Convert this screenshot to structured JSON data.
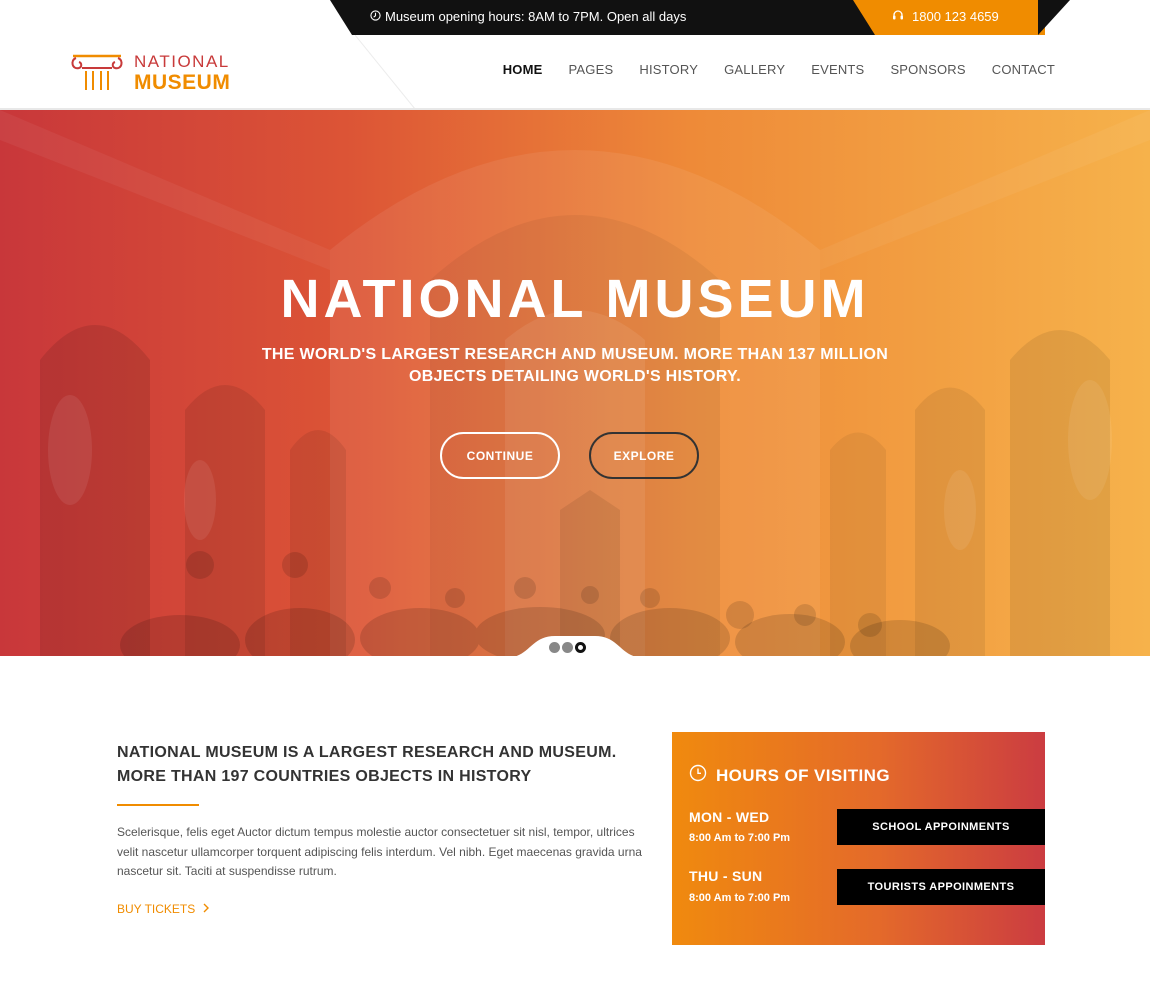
{
  "topbar": {
    "hours_note": "Museum opening hours: 8AM to 7PM. Open all days",
    "phone": "1800 123 4659"
  },
  "logo": {
    "line1": "NATIONAL",
    "line2": "MUSEUM"
  },
  "nav": {
    "items": [
      {
        "label": "HOME",
        "active": true
      },
      {
        "label": "PAGES"
      },
      {
        "label": "HISTORY"
      },
      {
        "label": "GALLERY"
      },
      {
        "label": "EVENTS"
      },
      {
        "label": "SPONSORS"
      },
      {
        "label": "CONTACT"
      }
    ]
  },
  "hero": {
    "title": "NATIONAL MUSEUM",
    "subtitle": "THE WORLD'S LARGEST RESEARCH AND MUSEUM. MORE THAN 137 MILLION OBJECTS DETAILING WORLD'S HISTORY.",
    "continue_label": "CONTINUE",
    "explore_label": "EXPLORE",
    "slides": 3,
    "active_slide": 3
  },
  "about": {
    "title": "NATIONAL MUSEUM IS A LARGEST RESEARCH AND MUSEUM. MORE THAN 197 COUNTRIES OBJECTS IN HISTORY",
    "body": "Scelerisque, felis eget Auctor dictum tempus molestie auctor consectetuer sit nisl, tempor, ultrices velit nascetur ullamcorper torquent adipiscing felis interdum. Vel nibh. Eget maecenas gravida urna nascetur sit. Taciti at suspendisse rutrum.",
    "buy_label": "BUY TICKETS"
  },
  "hours": {
    "title": "HOURS OF VISITING",
    "rows": [
      {
        "day": "MON - WED",
        "time": "8:00 Am to 7:00 Pm",
        "button": "SCHOOL APPOINMENTS"
      },
      {
        "day": "THU - SUN",
        "time": "8:00 Am to 7:00 Pm",
        "button": "TOURISTS APPOINMENTS"
      }
    ]
  },
  "colors": {
    "accent_orange": "#f08c00",
    "accent_red": "#c83a3a",
    "dark": "#111111"
  },
  "icons": [
    "clock-icon",
    "headphones-icon",
    "column-logo-icon",
    "chevron-right-icon"
  ]
}
